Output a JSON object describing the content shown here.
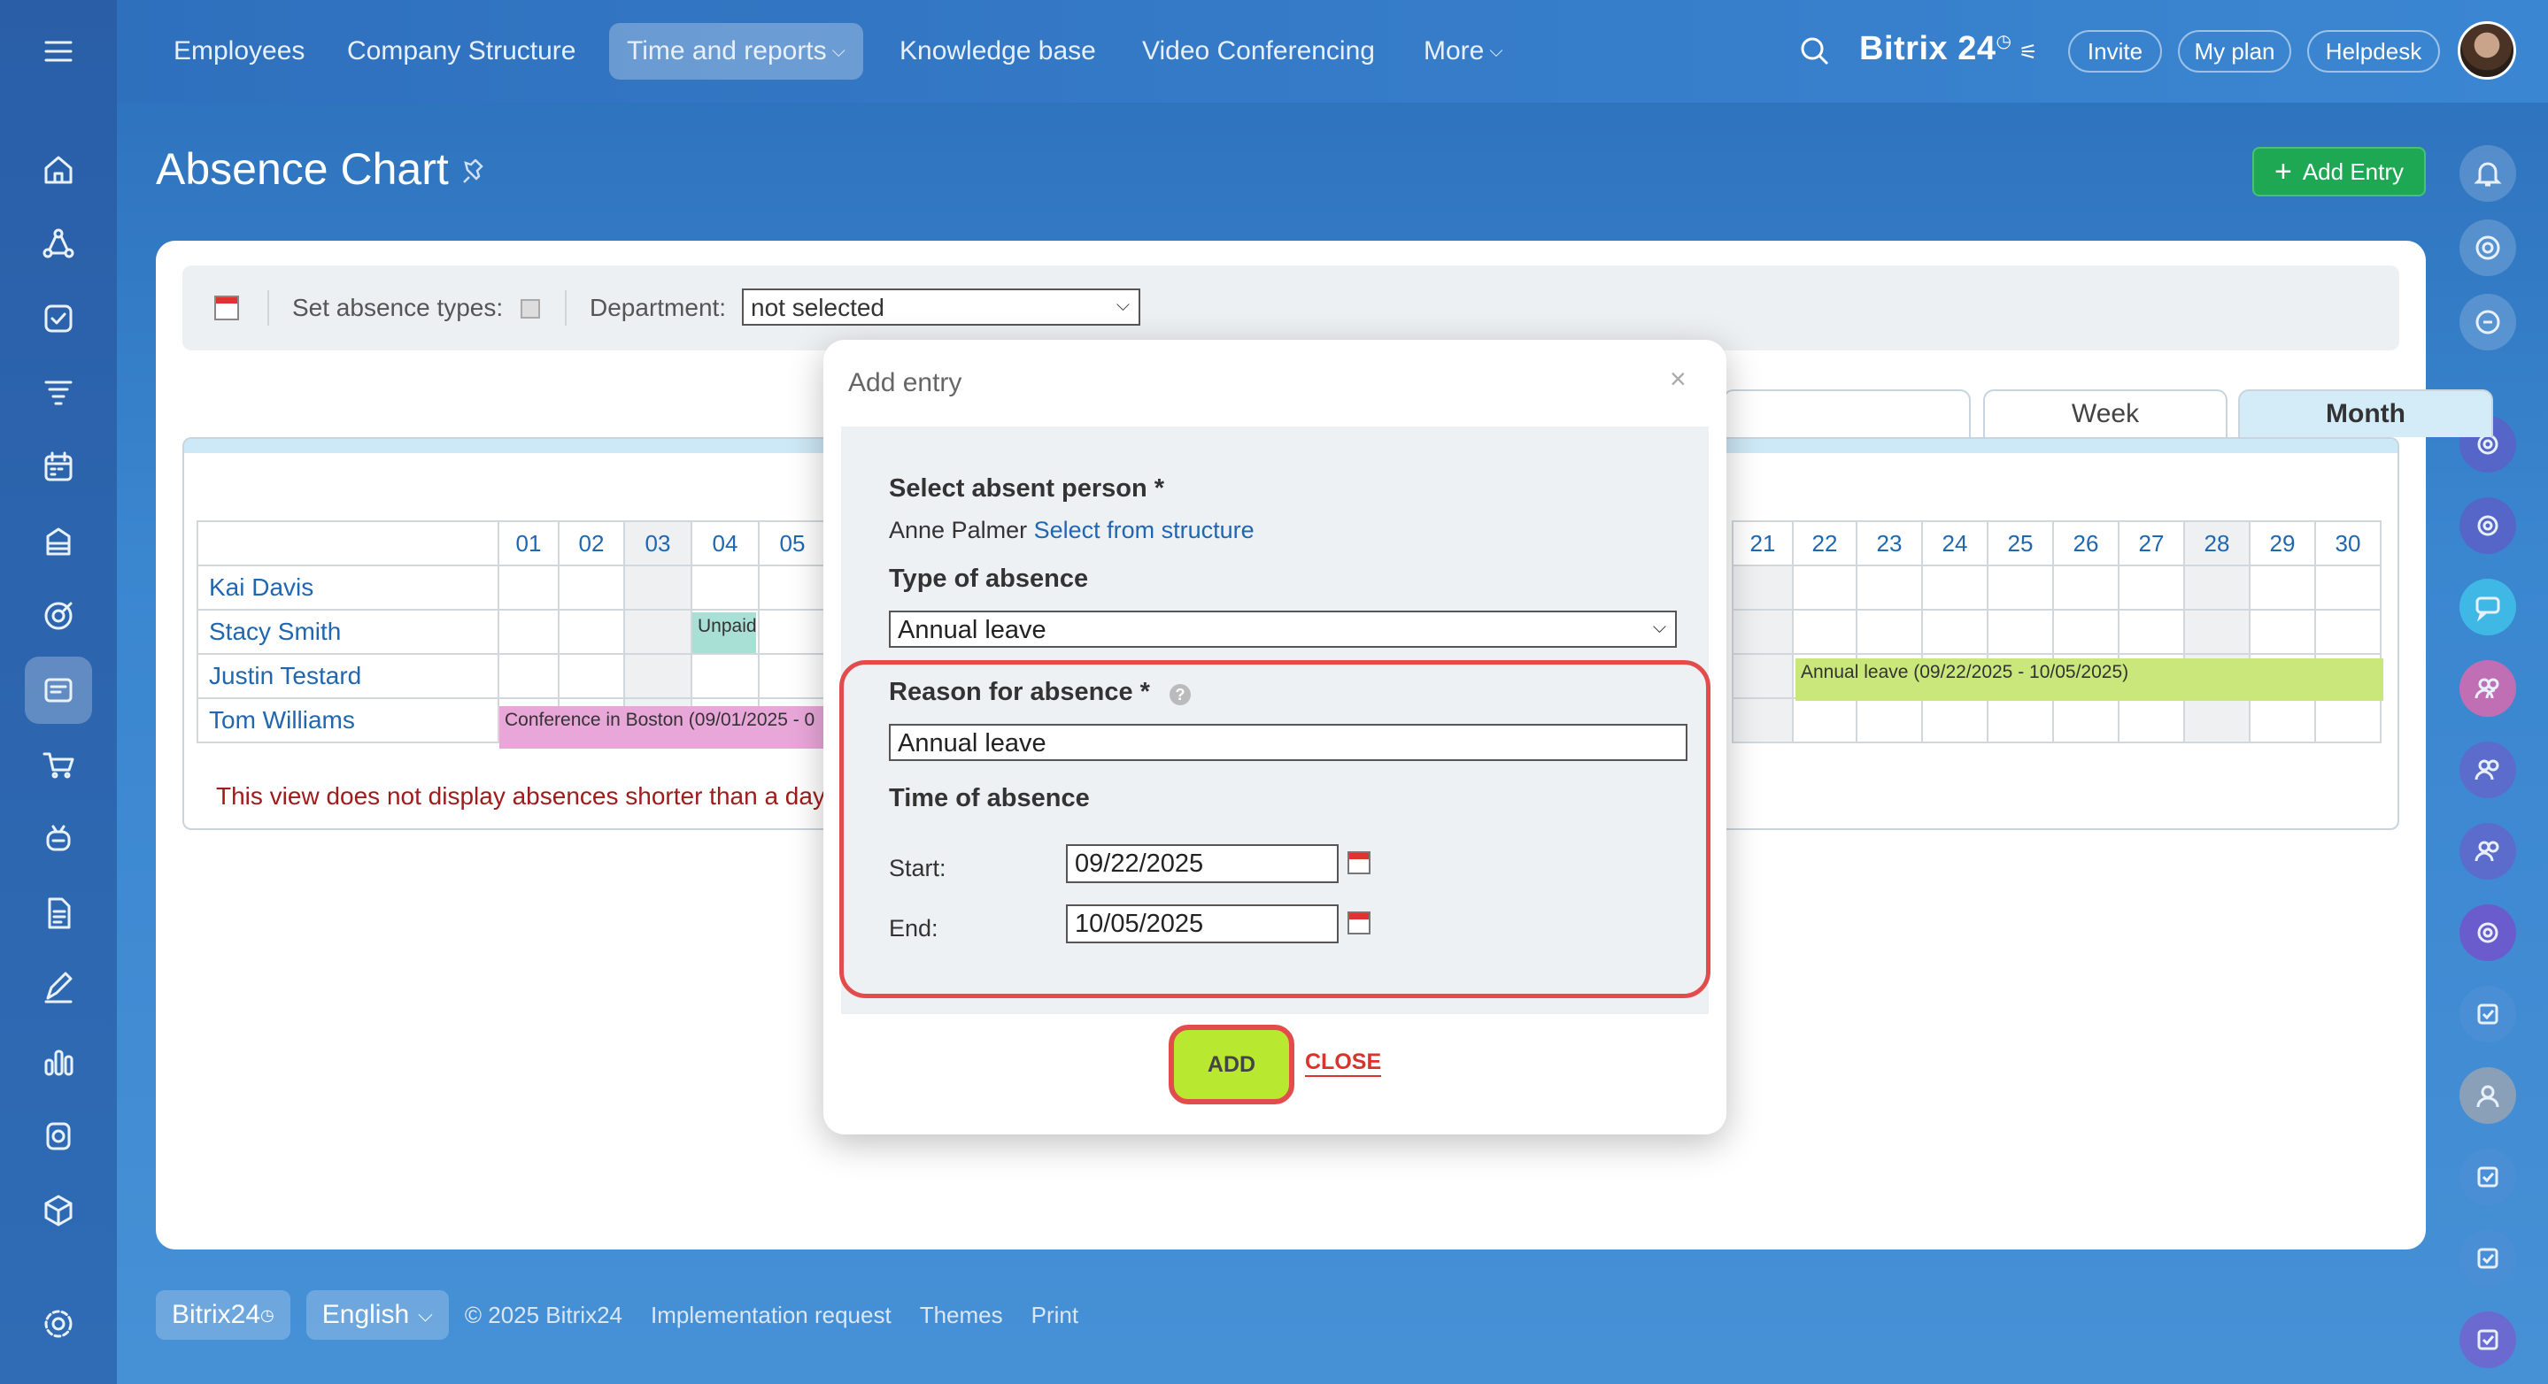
{
  "topnav": {
    "items": [
      "Employees",
      "Company Structure",
      "Time and reports",
      "Knowledge base",
      "Video Conferencing",
      "More"
    ],
    "brand": "Bitrix 24",
    "invite": "Invite",
    "myplan": "My plan",
    "helpdesk": "Helpdesk"
  },
  "page": {
    "title": "Absence Chart",
    "add_entry": "Add Entry"
  },
  "filter": {
    "set_types_label": "Set absence types:",
    "department_label": "Department:",
    "department_value": "not selected"
  },
  "tabs": {
    "week": "Week",
    "month": "Month"
  },
  "grid": {
    "days_left": [
      "01",
      "02",
      "03",
      "04",
      "05"
    ],
    "days_right": [
      "21",
      "22",
      "23",
      "24",
      "25",
      "26",
      "27",
      "28",
      "29",
      "30"
    ],
    "employees": [
      "Kai Davis",
      "Stacy Smith",
      "Justin Testard",
      "Tom Williams"
    ],
    "bars": {
      "unpaid": "Unpaid",
      "conference": "Conference in Boston (09/01/2025 - 0",
      "annual": "Annual leave (09/22/2025 - 10/05/2025)"
    },
    "warning": "This view does not display absences shorter than a day."
  },
  "modal": {
    "title": "Add entry",
    "close_x": "×",
    "person_label": "Select absent person *",
    "person_name": "Anne Palmer",
    "person_link": "Select from structure",
    "type_label": "Type of absence",
    "type_value": "Annual leave",
    "reason_label": "Reason for absence *",
    "reason_value": "Annual leave",
    "time_label": "Time of absence",
    "start_label": "Start:",
    "start_value": "09/22/2025",
    "end_label": "End:",
    "end_value": "10/05/2025",
    "add": "ADD",
    "close": "CLOSE"
  },
  "footer": {
    "brand_btn": "Bitrix24",
    "language": "English",
    "copyright": "© 2025 Bitrix24",
    "links": [
      "Implementation request",
      "Themes",
      "Print"
    ]
  },
  "colors": {
    "accent": "#2067b0",
    "add_entry": "#1fa853",
    "highlight": "#e34c4c",
    "add_btn": "#b8e830"
  }
}
